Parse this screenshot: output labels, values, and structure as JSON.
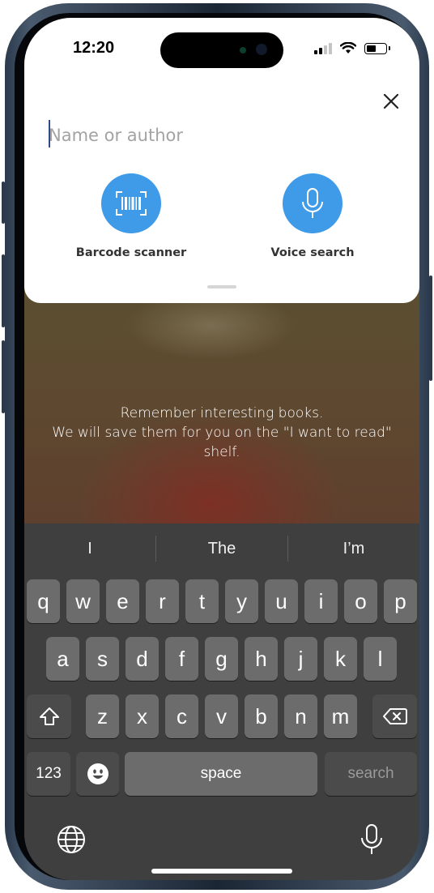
{
  "status_bar": {
    "time": "12:20"
  },
  "search": {
    "placeholder": "Name or author",
    "value": ""
  },
  "actions": {
    "barcode_label": "Barcode scanner",
    "voice_label": "Voice search"
  },
  "empty_state": {
    "line1": "Remember interesting books.",
    "line2": "We will save them for you on the \"I want to read\" shelf."
  },
  "keyboard": {
    "suggestions": [
      "I",
      "The",
      "I’m"
    ],
    "rows": [
      [
        "q",
        "w",
        "e",
        "r",
        "t",
        "y",
        "u",
        "i",
        "o",
        "p"
      ],
      [
        "a",
        "s",
        "d",
        "f",
        "g",
        "h",
        "j",
        "k",
        "l"
      ],
      [
        "z",
        "x",
        "c",
        "v",
        "b",
        "n",
        "m"
      ]
    ],
    "numbers_label": "123",
    "space_label": "space",
    "return_label": "search"
  },
  "icons": {
    "close": "close-icon",
    "barcode": "barcode-icon",
    "microphone": "microphone-icon",
    "shift": "shift-icon",
    "delete": "delete-icon",
    "emoji": "emoji-icon",
    "globe": "globe-icon",
    "dictation": "dictation-icon"
  },
  "colors": {
    "accent": "#3f9be8",
    "keyboard_bg": "#3f3f3f",
    "key": "#6c6c6c",
    "key_dark": "#4b4b4b"
  }
}
